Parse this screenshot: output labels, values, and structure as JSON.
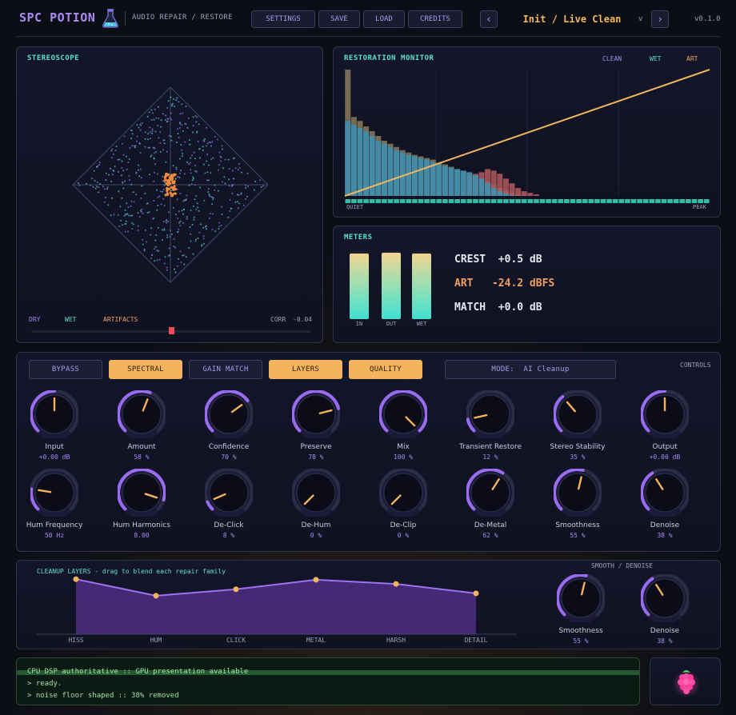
{
  "header": {
    "brand": "SPC POTION",
    "subtitle": "AUDIO REPAIR / RESTORE",
    "buttons": [
      "SETTINGS",
      "SAVE",
      "LOAD",
      "CREDITS"
    ],
    "prev": "‹",
    "next": "›",
    "preset": "Init / Live Clean",
    "preset_toggle": "v",
    "version": "v0.1.0"
  },
  "stereoscope": {
    "title": "STEREOSCOPE",
    "legend": [
      "DRY",
      "WET",
      "ARTIFACTS"
    ],
    "corr_label": "CORR",
    "corr_value": "-0.04",
    "balance": 0.5
  },
  "monitor": {
    "title": "RESTORATION MONITOR",
    "legend": {
      "clean": "CLEAN",
      "wet": "WET",
      "art": "ART"
    },
    "x_left": "QUIET",
    "x_right": "PEAK",
    "colors": {
      "clean": "#8b7a5a",
      "wet": "#3f8fae",
      "art": "#b45a5e",
      "line": "#f0b460"
    }
  },
  "chart_data": {
    "type": "bar",
    "title": "RESTORATION MONITOR",
    "xlabel": "",
    "ylabel": "",
    "x_range_labels": [
      "QUIET",
      "PEAK"
    ],
    "series": [
      {
        "name": "CLEAN",
        "values": [
          160,
          100,
          95,
          88,
          82,
          76,
          70,
          66,
          62,
          58,
          55,
          52,
          50,
          48,
          46,
          42,
          40,
          37,
          34,
          32,
          30,
          26,
          22,
          18,
          14,
          10,
          6,
          4,
          2,
          1,
          0,
          0,
          0,
          0,
          0,
          0,
          0,
          0,
          0,
          0,
          0,
          0,
          0,
          0,
          0,
          0,
          0,
          0,
          0,
          0,
          0,
          0,
          0,
          0,
          0,
          0,
          0,
          0,
          0,
          0
        ]
      },
      {
        "name": "WET",
        "values": [
          95,
          90,
          86,
          82,
          76,
          70,
          66,
          62,
          58,
          55,
          52,
          50,
          48,
          46,
          43,
          40,
          38,
          36,
          34,
          32,
          30,
          26,
          22,
          16,
          10,
          6,
          3,
          1,
          0,
          0,
          0,
          0,
          0,
          0,
          0,
          0,
          0,
          0,
          0,
          0,
          0,
          0,
          0,
          0,
          0,
          0,
          0,
          0,
          0,
          0,
          0,
          0,
          0,
          0,
          0,
          0,
          0,
          0,
          0,
          0
        ]
      },
      {
        "name": "ART",
        "values": [
          0,
          0,
          0,
          0,
          0,
          0,
          0,
          0,
          0,
          0,
          0,
          0,
          0,
          0,
          0,
          0,
          0,
          0,
          0,
          0,
          26,
          28,
          30,
          34,
          32,
          28,
          22,
          16,
          10,
          6,
          4,
          2,
          0,
          0,
          0,
          0,
          0,
          0,
          0,
          0,
          0,
          0,
          0,
          0,
          0,
          0,
          0,
          0,
          0,
          0,
          0,
          0,
          0,
          0,
          0,
          0,
          0,
          0,
          0,
          0
        ]
      }
    ],
    "line": {
      "from": [
        0,
        0
      ],
      "to": [
        1,
        1
      ]
    },
    "ylim": [
      0,
      160
    ]
  },
  "meters": {
    "title": "METERS",
    "bars": [
      {
        "label": "IN",
        "level": 0.95
      },
      {
        "label": "OUT",
        "level": 0.97
      },
      {
        "label": "WET",
        "level": 0.95
      }
    ],
    "crest_label": "CREST",
    "crest_value": "+0.5 dB",
    "art_label": "ART",
    "art_value": "-24.2 dBFS",
    "match_label": "MATCH",
    "match_value": "+0.0 dB"
  },
  "controls": {
    "label": "CONTROLS",
    "toggles": [
      {
        "label": "BYPASS",
        "on": false
      },
      {
        "label": "SPECTRAL",
        "on": true
      },
      {
        "label": "GAIN MATCH",
        "on": false
      },
      {
        "label": "LAYERS",
        "on": true
      },
      {
        "label": "QUALITY",
        "on": true
      }
    ],
    "mode_label": "MODE:",
    "mode_value": "AI Cleanup",
    "knobs": [
      {
        "label": "Input",
        "value": "+0.00 dB",
        "pos": 0.5
      },
      {
        "label": "Amount",
        "value": "58 %",
        "pos": 0.58
      },
      {
        "label": "Confidence",
        "value": "70 %",
        "pos": 0.7
      },
      {
        "label": "Preserve",
        "value": "78 %",
        "pos": 0.78
      },
      {
        "label": "Mix",
        "value": "100 %",
        "pos": 1.0
      },
      {
        "label": "Transient Restore",
        "value": "12 %",
        "pos": 0.12
      },
      {
        "label": "Stereo Stability",
        "value": "35 %",
        "pos": 0.35
      },
      {
        "label": "Output",
        "value": "+0.00 dB",
        "pos": 0.5
      },
      {
        "label": "Hum Frequency",
        "value": "50 Hz",
        "pos": 0.2
      },
      {
        "label": "Hum Harmonics",
        "value": "8.00",
        "pos": 0.9
      },
      {
        "label": "De-Click",
        "value": "8 %",
        "pos": 0.08
      },
      {
        "label": "De-Hum",
        "value": "0 %",
        "pos": 0.0
      },
      {
        "label": "De-Clip",
        "value": "0 %",
        "pos": 0.0
      },
      {
        "label": "De-Metal",
        "value": "62 %",
        "pos": 0.62
      },
      {
        "label": "Smoothness",
        "value": "55 %",
        "pos": 0.55
      },
      {
        "label": "Denoise",
        "value": "38 %",
        "pos": 0.38
      }
    ]
  },
  "layers": {
    "title": "CLEANUP LAYERS - drag to blend each repair family",
    "points": [
      {
        "label": "HISS",
        "level": 0.93
      },
      {
        "label": "HUM",
        "level": 0.65
      },
      {
        "label": "CLICK",
        "level": 0.76
      },
      {
        "label": "METAL",
        "level": 0.92
      },
      {
        "label": "HARSH",
        "level": 0.85
      },
      {
        "label": "DETAIL",
        "level": 0.69
      }
    ],
    "side_title": "SMOOTH / DENOISE",
    "side_knobs": [
      {
        "label": "Smoothness",
        "value": "55 %",
        "pos": 0.55
      },
      {
        "label": "Denoise",
        "value": "38 %",
        "pos": 0.38
      }
    ]
  },
  "console": {
    "lines": [
      "CPU DSP authoritative :: GPU presentation available",
      "> ready.",
      "> noise floor shaped :: 38% removed"
    ]
  }
}
